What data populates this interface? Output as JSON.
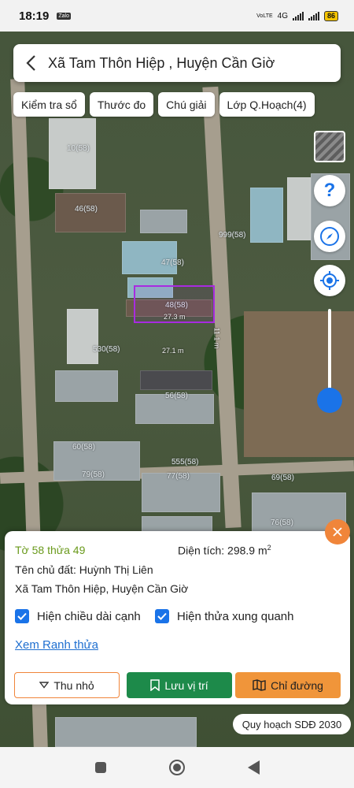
{
  "status": {
    "time": "18:19",
    "app_badge": "Zalo",
    "network": "4G",
    "volte": "VoLTE",
    "battery": "86"
  },
  "header": {
    "title": "Xã Tam Thôn Hiệp , Huyện Cần Giờ"
  },
  "toolbar": {
    "check_book": "Kiểm tra sổ",
    "measure": "Thước đo",
    "legend": "Chú giải",
    "planning_layer": "Lớp Q.Hoạch(4)"
  },
  "map": {
    "parcel_labels": [
      "10(58)",
      "46(58)",
      "47(58)",
      "48(58)",
      "530(58)",
      "56(58)",
      "60(58)",
      "555(58)",
      "77(58)",
      "79(58)",
      "76(58)",
      "69(58)",
      "999(58)"
    ],
    "edge_top": "27.3 m",
    "edge_bottom": "27.1 m",
    "edge_right": "11.1 m",
    "icons": {
      "help": "help-icon",
      "compass": "compass-icon",
      "locate": "locate-icon",
      "layers": "layer-thumbnail"
    }
  },
  "info": {
    "sheet_parcel": "Tờ 58 thửa 49",
    "area_label": "Diện tích: 298.9 m",
    "area_sup": "2",
    "owner": "Tên chủ đất: Huỳnh Thị Liên",
    "address": "Xã Tam Thôn Hiệp, Huyện Cần Giờ",
    "show_edge_lengths": "Hiện chiều dài cạnh",
    "show_neighbors": "Hiện thửa xung quanh",
    "view_parcel_link": "Xem Ranh thửa",
    "collapse": "Thu nhỏ",
    "save_location": "Lưu vị trí",
    "directions": "Chỉ đường"
  },
  "plan_badge": "Quy hoạch SDĐ 2030",
  "colors": {
    "accent_blue": "#1a73e8",
    "orange": "#f0853a",
    "green": "#1d8a4a",
    "parcel_border": "#a82be0"
  }
}
